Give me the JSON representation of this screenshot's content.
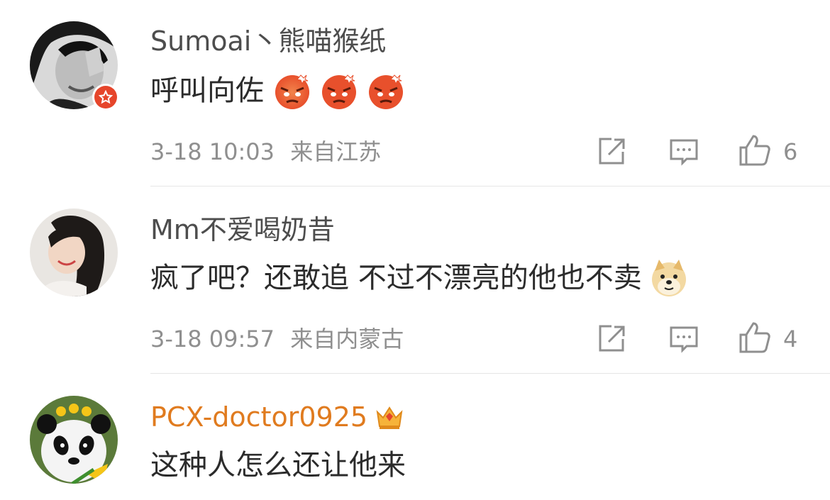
{
  "comments": [
    {
      "username": "Sumoai丶熊喵猴纸",
      "text": "呼叫向佐",
      "emoji": "angry-face-emoji",
      "time": "3-18 10:03",
      "location": "来自江苏",
      "likes": "6",
      "verified": true
    },
    {
      "username": "Mm不爱喝奶昔",
      "text": "疯了吧？还敢追 不过不漂亮的他也不卖",
      "emoji": "doge-emoji",
      "time": "3-18 09:57",
      "location": "来自内蒙古",
      "likes": "4",
      "verified": false
    },
    {
      "username": "PCX-doctor0925",
      "text": "这种人怎么还让他来",
      "badge": "crown-icon",
      "verified": false
    }
  ],
  "colors": {
    "username": "#4d4d4d",
    "vip_username": "#e07b1f",
    "meta": "#8f8f8f",
    "verified_badge": "#e6452b",
    "divider": "#e6e6e6"
  }
}
